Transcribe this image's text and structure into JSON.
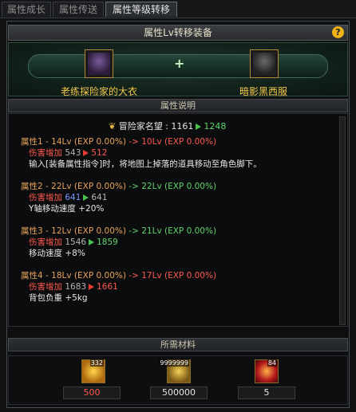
{
  "tabs": [
    "属性成长",
    "属性传送",
    "属性等级转移"
  ],
  "header": {
    "title": "属性Lv转移装备",
    "help": "?"
  },
  "items": {
    "left_name": "老练探险家的大衣",
    "right_name": "暗影黑西服",
    "plus": "+"
  },
  "desc_header": "属性说明",
  "fame": {
    "label": "冒险家名望 : 1161",
    "new": "1248"
  },
  "props": [
    {
      "title": "属性1 - 14Lv (EXP 0.00%)",
      "arrow": "->",
      "target": "10Lv (EXP 0.00%)",
      "stat": "伤害增加",
      "from": "543",
      "to": "512",
      "trend": "down",
      "effect": "输入[装备属性指令]时，将地图上掉落的道具移动至角色脚下。"
    },
    {
      "title": "属性2 - 22Lv (EXP 0.00%)",
      "arrow": "->",
      "target": "22Lv (EXP 0.00%)",
      "stat": "伤害增加",
      "from": "641",
      "to": "641",
      "trend": "same",
      "effect": "Y轴移动速度 +20%"
    },
    {
      "title": "属性3 - 12Lv (EXP 0.00%)",
      "arrow": "->",
      "target": "21Lv (EXP 0.00%)",
      "stat": "伤害增加",
      "from": "1546",
      "to": "1859",
      "trend": "up",
      "effect": "移动速度 +8%"
    },
    {
      "title": "属性4 - 18Lv (EXP 0.00%)",
      "arrow": "->",
      "target": "17Lv (EXP 0.00%)",
      "stat": "伤害增加",
      "from": "1683",
      "to": "1661",
      "trend": "down",
      "effect": "背包负重 +5kg"
    }
  ],
  "materials_header": "所需材料",
  "materials": [
    {
      "icon": "gold-crystal-icon",
      "count": "332",
      "required": "500",
      "enough": false
    },
    {
      "icon": "gold-coins-icon",
      "count": "9999999",
      "required": "500000",
      "enough": true
    },
    {
      "icon": "burst-orb-icon",
      "count": "84",
      "required": "5",
      "enough": true
    }
  ]
}
